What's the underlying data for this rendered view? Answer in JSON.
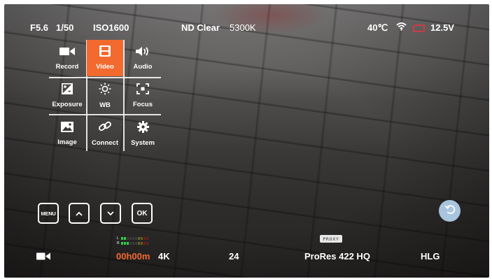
{
  "status_bar": {
    "aperture": "F5.6",
    "shutter": "1/50",
    "iso": "ISO1600",
    "nd": "ND Clear",
    "white_balance": "5300K",
    "temperature": "40℃",
    "wifi_icon": "wifi-icon",
    "battery_icon": "battery-icon",
    "voltage": "12.5V"
  },
  "menu": {
    "items": [
      {
        "label": "Record",
        "icon": "camcorder-icon"
      },
      {
        "label": "Video",
        "icon": "film-icon",
        "active": true
      },
      {
        "label": "Audio",
        "icon": "speaker-icon"
      },
      {
        "label": "Exposure",
        "icon": "exposure-icon"
      },
      {
        "label": "WB",
        "icon": "sun-icon"
      },
      {
        "label": "Focus",
        "icon": "focus-icon"
      },
      {
        "label": "Image",
        "icon": "image-icon"
      },
      {
        "label": "Connect",
        "icon": "link-icon"
      },
      {
        "label": "System",
        "icon": "gear-icon"
      }
    ],
    "active_color": "#f26a2e"
  },
  "nav": {
    "menu_label": "MENU",
    "up_icon": "chevron-up-icon",
    "down_icon": "chevron-down-icon",
    "ok_label": "OK",
    "back_icon": "back-arrow-icon"
  },
  "bottom_bar": {
    "record_icon": "camcorder-icon",
    "meter_left_label": "L",
    "meter_right_label": "R",
    "timecode": "00h00m",
    "resolution": "4K",
    "frame_rate": "24",
    "proxy_badge": "PROXY",
    "codec": "ProRes 422 HQ",
    "gamma": "HLG",
    "timecode_color": "#f26a2e"
  }
}
